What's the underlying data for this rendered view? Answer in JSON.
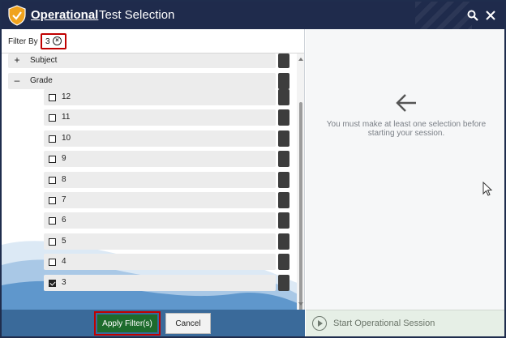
{
  "titlebar": {
    "brand": "Operational",
    "title": "Test Selection",
    "search_icon": "search-icon",
    "close_icon": "close-icon"
  },
  "filter": {
    "label": "Filter By",
    "chip_value": "3",
    "chip_icon": "clear-circle-icon"
  },
  "tree": {
    "subject": {
      "label": "Subject",
      "toggle": "+"
    },
    "grade": {
      "label": "Grade",
      "toggle": "–"
    },
    "grades": [
      {
        "label": "12",
        "checked": false
      },
      {
        "label": "11",
        "checked": false
      },
      {
        "label": "10",
        "checked": false
      },
      {
        "label": "9",
        "checked": false
      },
      {
        "label": "8",
        "checked": false
      },
      {
        "label": "7",
        "checked": false
      },
      {
        "label": "6",
        "checked": false
      },
      {
        "label": "5",
        "checked": false
      },
      {
        "label": "4",
        "checked": false
      },
      {
        "label": "3",
        "checked": true
      }
    ]
  },
  "footer": {
    "apply_label": "Apply Filter(s)",
    "cancel_label": "Cancel",
    "start_label": "Start Operational Session"
  },
  "right": {
    "message": "You must make at least one selection before starting your session."
  },
  "colors": {
    "titlebar": "#1f2b4c",
    "apply_button": "#1d6b2c",
    "highlight_border": "#c00000",
    "shield": "#f0a31e"
  }
}
